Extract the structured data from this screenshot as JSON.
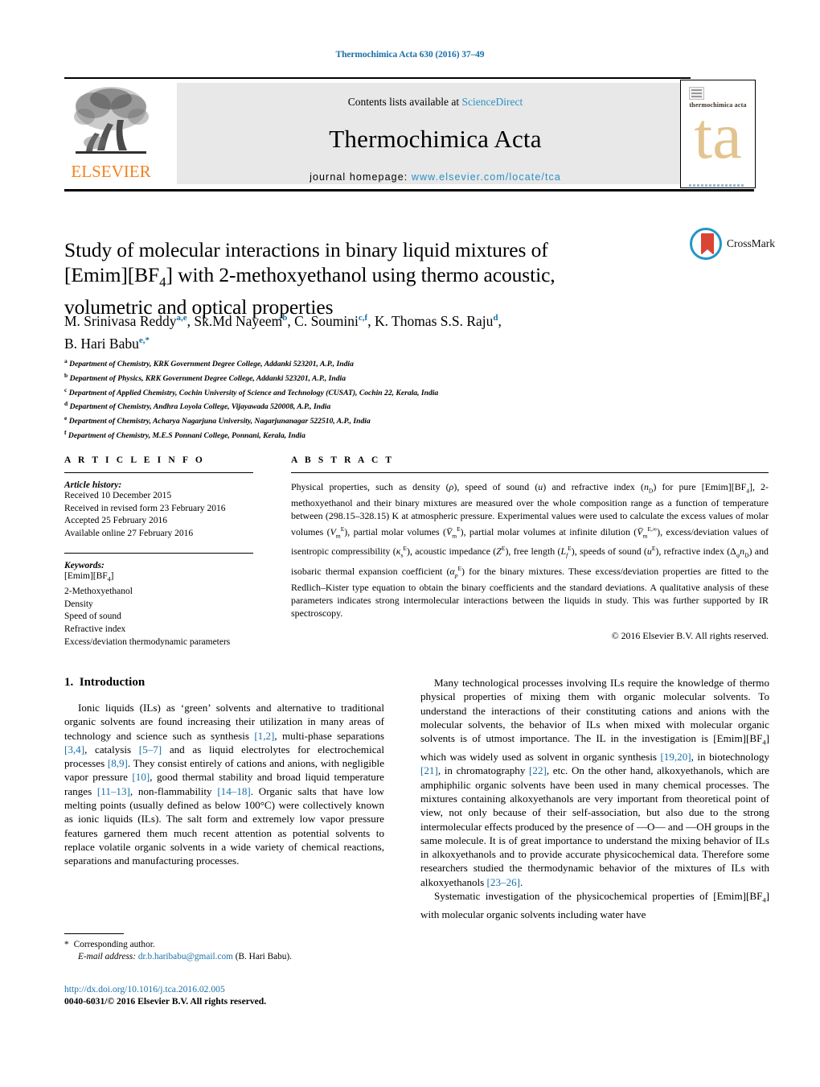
{
  "running_head": "Thermochimica Acta 630 (2016) 37–49",
  "header": {
    "contents_prefix": "Contents lists available at ",
    "sciencedirect": "ScienceDirect",
    "journal_name": "Thermochimica Acta",
    "homepage_prefix": "journal homepage: ",
    "homepage_url": "www.elsevier.com/locate/tca",
    "publisher_logo_text": "ELSEVIER",
    "publisher_logo_icon": "elsevier-tree-icon",
    "cover_title": "thermochimica acta",
    "cover_monogram": "ta"
  },
  "article": {
    "title_line1": "Study of molecular interactions in binary liquid mixtures of",
    "title_line2_a": "[Emim][BF",
    "title_line2_sub": "4",
    "title_line2_b": "] with 2-methoxyethanol using thermo acoustic,",
    "title_line3": "volumetric and optical properties",
    "crossmark_label": "CrossMark"
  },
  "authors": [
    {
      "name": "M. Srinivasa Reddy",
      "sup": "a,e",
      "sep": ", "
    },
    {
      "name": "Sk.Md Nayeem",
      "sup": "b",
      "sep": ", "
    },
    {
      "name": "C. Soumini",
      "sup": "c,f",
      "sep": ", "
    },
    {
      "name": "K. Thomas S.S. Raju",
      "sup": "d",
      "sep": ","
    },
    {
      "name": "B. Hari Babu",
      "sup": "e,*",
      "sep": ""
    }
  ],
  "affiliations": [
    {
      "mark": "a",
      "text": "Department of Chemistry, KRK Government Degree College, Addanki 523201, A.P., India"
    },
    {
      "mark": "b",
      "text": "Department of Physics, KRK Government Degree College, Addanki 523201, A.P., India"
    },
    {
      "mark": "c",
      "text": "Department of Applied Chemistry, Cochin University of Science and Technology (CUSAT), Cochin 22, Kerala, India"
    },
    {
      "mark": "d",
      "text": "Department of Chemistry, Andhra Loyola College, Vijayawada 520008, A.P., India"
    },
    {
      "mark": "e",
      "text": "Department of Chemistry, Acharya Nagarjuna University, Nagarjunanagar 522510, A.P., India"
    },
    {
      "mark": "f",
      "text": "Department of Chemistry, M.E.S Ponnani College, Ponnani, Kerala, India"
    }
  ],
  "article_info": {
    "heading": "A R T I C L E   I N F O",
    "history_label": "Article history:",
    "history": [
      "Received 10 December 2015",
      "Received in revised form 23 February 2016",
      "Accepted 25 February 2016",
      "Available online 27 February 2016"
    ],
    "keywords_label": "Keywords:",
    "keywords": [
      "[Emim][BF4]",
      "2-Methoxyethanol",
      "Density",
      "Speed of sound",
      "Refractive index",
      "Excess/deviation thermodynamic parameters"
    ]
  },
  "abstract": {
    "heading": "A B S T R A C T",
    "copyright": "© 2016 Elsevier B.V. All rights reserved."
  },
  "body": {
    "section_number": "1.",
    "section_title": "Introduction",
    "left_paragraph_refs": [
      "[1,2]",
      "[3,4]",
      "[5–7]",
      "[8,9]",
      "[10]",
      "[11–13]",
      "[14–18]"
    ],
    "right_paragraph_refs": [
      "[19,20]",
      "[21]",
      "[22]",
      "[23–26]"
    ]
  },
  "footer": {
    "star": "*",
    "corresponding": "Corresponding author.",
    "email_label": "E-mail address:",
    "email": "dr.b.haribabu@gmail.com",
    "email_owner": "(B. Hari Babu).",
    "doi_url": "http://dx.doi.org/10.1016/j.tca.2016.02.005",
    "issn_line": "0040-6031/© 2016 Elsevier B.V. All rights reserved."
  },
  "colors": {
    "link": "#1a6fa8",
    "sciencedirect": "#2b90c4",
    "elsevier_orange": "#F58220",
    "crossmark_blue": "#2196c9",
    "crossmark_red": "#d94436",
    "cover_tan": "#e3c48f",
    "band_gray": "#e8e8e8"
  }
}
